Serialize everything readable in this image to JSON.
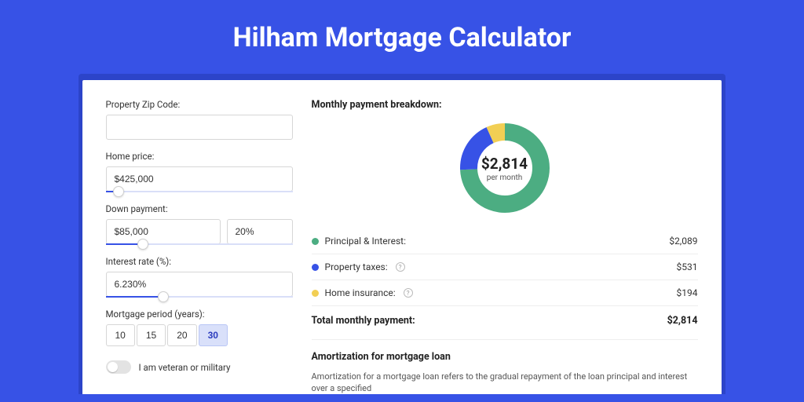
{
  "title": "Hilham Mortgage Calculator",
  "form": {
    "zip_label": "Property Zip Code:",
    "zip_value": "",
    "price_label": "Home price:",
    "price_value": "$425,000",
    "price_slider_pct": 7,
    "down_label": "Down payment:",
    "down_value": "$85,000",
    "down_pct_value": "20%",
    "down_slider_pct": 20,
    "rate_label": "Interest rate (%):",
    "rate_value": "6.230%",
    "rate_slider_pct": 31,
    "period_label": "Mortgage period (years):",
    "period_options": [
      "10",
      "15",
      "20",
      "30"
    ],
    "period_active_index": 3,
    "veteran_label": "I am veteran or military",
    "veteran_on": false
  },
  "breakdown": {
    "title": "Monthly payment breakdown:",
    "total_amount": "$2,814",
    "total_sub": "per month",
    "items": [
      {
        "label": "Principal & Interest:",
        "amount": "$2,089",
        "color": "#4cad82",
        "numeric": 2089,
        "info": false
      },
      {
        "label": "Property taxes:",
        "amount": "$531",
        "color": "#3752e6",
        "numeric": 531,
        "info": true
      },
      {
        "label": "Home insurance:",
        "amount": "$194",
        "color": "#f2cf54",
        "numeric": 194,
        "info": true
      }
    ],
    "total_label": "Total monthly payment:",
    "total_value": "$2,814"
  },
  "amort": {
    "title": "Amortization for mortgage loan",
    "text": "Amortization for a mortgage loan refers to the gradual repayment of the loan principal and interest over a specified"
  },
  "chart_data": {
    "type": "pie",
    "title": "Monthly payment breakdown",
    "series": [
      {
        "name": "Principal & Interest",
        "value": 2089,
        "color": "#4cad82"
      },
      {
        "name": "Property taxes",
        "value": 531,
        "color": "#3752e6"
      },
      {
        "name": "Home insurance",
        "value": 194,
        "color": "#f2cf54"
      }
    ],
    "total": 2814
  }
}
